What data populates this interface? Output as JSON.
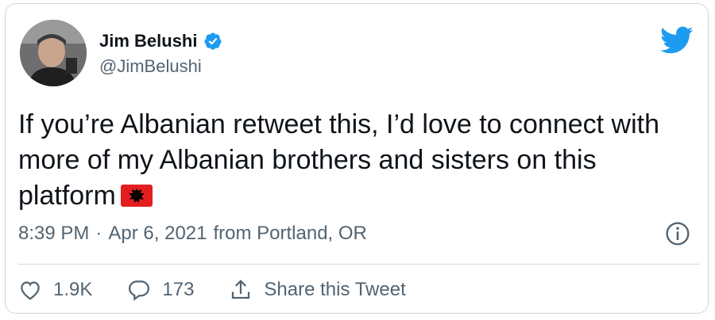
{
  "tweet": {
    "display_name": "Jim Belushi",
    "handle": "@JimBelushi",
    "verified": true,
    "text_line1": "If you’re Albanian retweet this, I’d love to connect with",
    "text_line2": "more of my Albanian brothers and sisters on this",
    "text_line3": "platform",
    "emoji": "albanian-flag-emoji",
    "time": "8:39 PM",
    "separator": "·",
    "date": "Apr 6, 2021",
    "location": "from Portland, OR"
  },
  "actions": {
    "likes": "1.9K",
    "replies": "173",
    "share_label": "Share this Tweet"
  },
  "icons": {
    "brand": "twitter-bird-icon",
    "verified": "verified-badge-icon",
    "info": "info-icon",
    "like": "heart-icon",
    "reply": "reply-bubble-icon",
    "share": "share-icon"
  },
  "colors": {
    "twitter_blue": "#1d9bf0",
    "secondary_text": "#536471",
    "flag_red": "#e41e20"
  }
}
